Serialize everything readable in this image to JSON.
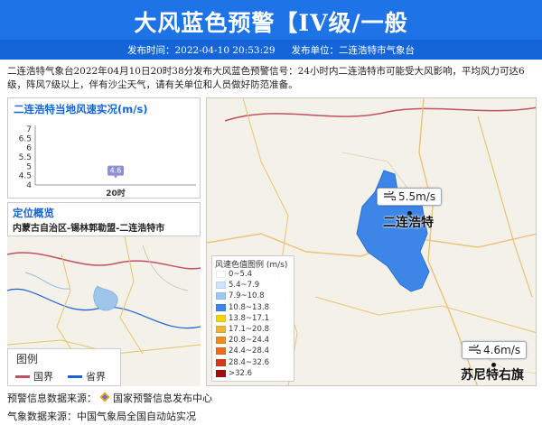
{
  "header": {
    "title": "大风蓝色预警【IV级/一般",
    "publish_time_label": "发布时间：2022-04-10 20:53:29",
    "publisher_label": "发布单位：二连浩特市气象台"
  },
  "description": "二连浩特气象台2022年04月10日20时38分发布大风蓝色预警信号：24小时内二连浩特市可能受大风影响，平均风力可达6级，阵风7级以上，伴有沙尘天气，请有关单位和人员做好防范准备。",
  "wind_panel": {
    "title": "二连浩特当地风速实况(m/s)"
  },
  "chart_data": {
    "type": "scatter",
    "title": "二连浩特当地风速实况(m/s)",
    "categories": [
      "20时"
    ],
    "values": [
      4.6
    ],
    "value_labels": [
      "4.6"
    ],
    "y_ticks": [
      "4",
      "4.5",
      "5",
      "5.5",
      "6",
      "6.5",
      "7"
    ],
    "ylim": [
      4,
      7
    ]
  },
  "location_panel": {
    "title": "定位概览",
    "path": "内蒙古自治区-锡林郭勒盟-二连浩特市"
  },
  "small_map_legend": {
    "title": "图例",
    "items": [
      {
        "label": "国界",
        "color": "#c0506a"
      },
      {
        "label": "省界",
        "color": "#1f5fd6"
      }
    ]
  },
  "wind_legend": {
    "title": "风速色值图例 (m/s)",
    "items": [
      {
        "label": "0~5.4",
        "color": "#ffffff"
      },
      {
        "label": "5.4~7.9",
        "color": "#cfe4fb"
      },
      {
        "label": "7.9~10.8",
        "color": "#9dcaf5"
      },
      {
        "label": "10.8~13.8",
        "color": "#3d86e8"
      },
      {
        "label": "13.8~17.1",
        "color": "#f2d600"
      },
      {
        "label": "17.1~20.8",
        "color": "#f0b430"
      },
      {
        "label": "20.8~24.4",
        "color": "#f08c1e"
      },
      {
        "label": "24.4~28.4",
        "color": "#ee6b1a"
      },
      {
        "label": "28.4~32.6",
        "color": "#d43a1a"
      },
      {
        "label": ">32.6",
        "color": "#9e1010"
      }
    ]
  },
  "stations": [
    {
      "name": "二连浩特",
      "speed": "5.5m/s"
    },
    {
      "name": "苏尼特右旗",
      "speed": "4.6m/s"
    }
  ],
  "footer": {
    "alert_source": "预警信息数据来源：",
    "alert_source_org": "国家预警信息发布中心",
    "weather_source": "气象数据来源：中国气象局全国自动站实况"
  },
  "colors": {
    "banner": "#1e73e6",
    "meta_bar": "#1565d8",
    "alert_area": "#3d86e8"
  }
}
